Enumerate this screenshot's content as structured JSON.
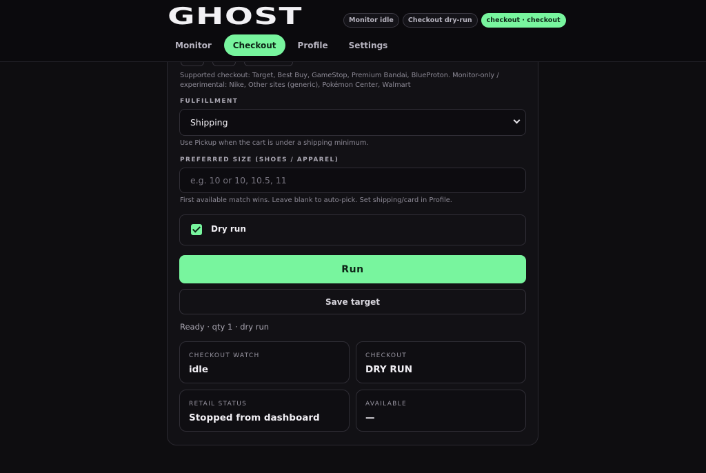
{
  "header": {
    "logo": "GHOST",
    "pills": [
      {
        "label": "Monitor idle",
        "active": false
      },
      {
        "label": "Checkout dry-run",
        "active": false
      },
      {
        "label": "checkout · checkout",
        "active": true
      }
    ],
    "tabs": [
      {
        "label": "Monitor",
        "active": false
      },
      {
        "label": "Checkout",
        "active": true
      },
      {
        "label": "Profile",
        "active": false
      },
      {
        "label": "Settings",
        "active": false
      }
    ]
  },
  "form": {
    "supported_help": "Supported checkout: Target, Best Buy, GameStop, Premium Bandai, BlueProton. Monitor-only / experimental: Nike, Other sites (generic), Pokémon Center, Walmart",
    "fulfillment": {
      "label": "FULFILLMENT",
      "selected": "Shipping",
      "help": "Use Pickup when the cart is under a shipping minimum."
    },
    "size": {
      "label": "PREFERRED SIZE (SHOES / APPAREL)",
      "value": "",
      "placeholder": "e.g. 10 or 10, 10.5, 11",
      "help": "First available match wins. Leave blank to auto-pick. Set shipping/card in Profile."
    },
    "dry_run": {
      "label": "Dry run",
      "checked": true
    },
    "run_label": "Run",
    "save_label": "Save target",
    "status": "Ready · qty 1 · dry run"
  },
  "stats": [
    {
      "label": "CHECKOUT WATCH",
      "value": "idle"
    },
    {
      "label": "CHECKOUT",
      "value": "DRY RUN"
    },
    {
      "label": "RETAIL STATUS",
      "value": "Stopped from dashboard"
    },
    {
      "label": "AVAILABLE",
      "value": "—"
    }
  ],
  "colors": {
    "accent": "#78f59e",
    "background": "#0e0d10"
  }
}
